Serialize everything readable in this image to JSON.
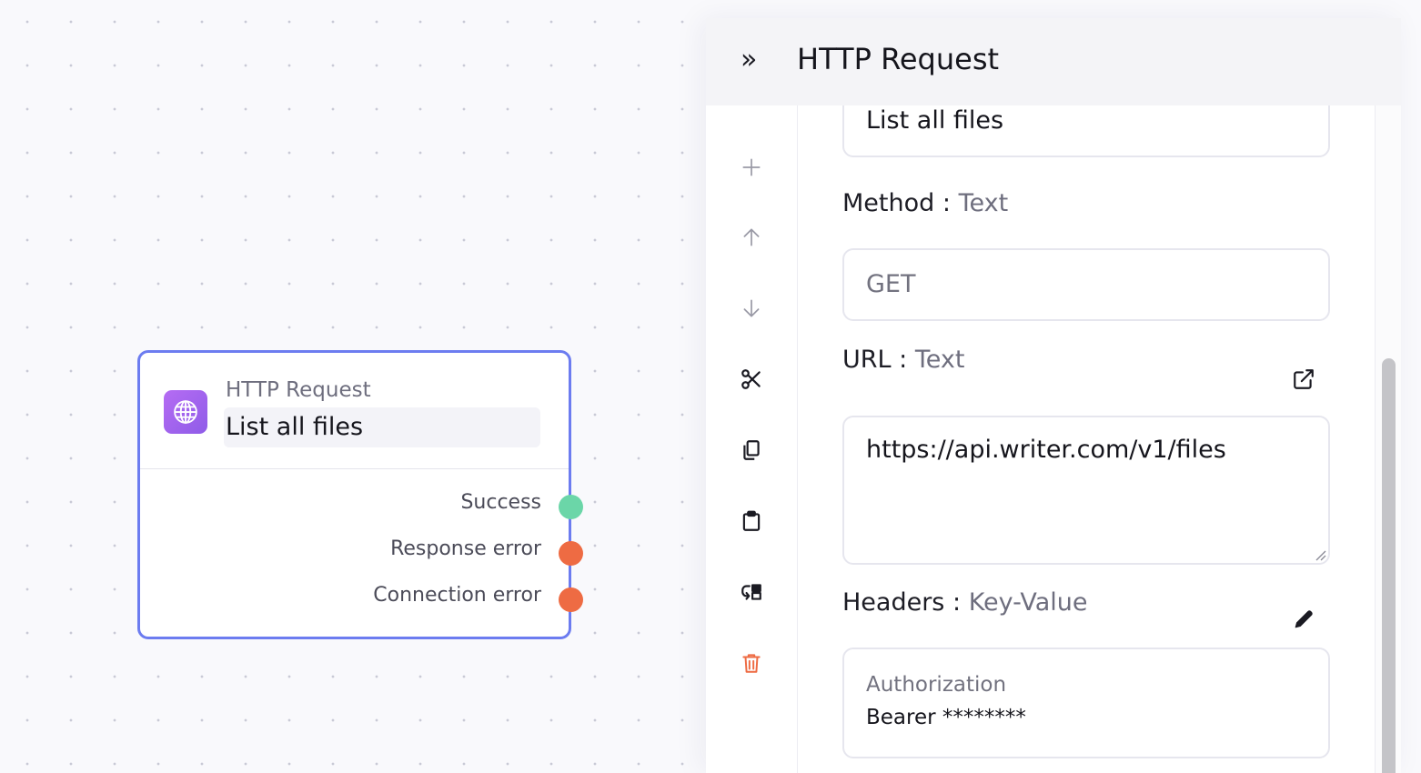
{
  "node": {
    "type_label": "HTTP Request",
    "title": "List all files",
    "outputs": [
      {
        "label": "Success",
        "status": "success",
        "color": "#6bd6a8"
      },
      {
        "label": "Response error",
        "status": "error",
        "color": "#ee6b43"
      },
      {
        "label": "Connection error",
        "status": "error",
        "color": "#ee6b43"
      }
    ]
  },
  "panel": {
    "collapse_glyph": "»",
    "title": "HTTP Request",
    "toolbar": [
      {
        "icon": "plus-icon"
      },
      {
        "icon": "arrow-up-icon"
      },
      {
        "icon": "arrow-down-icon"
      },
      {
        "icon": "scissors-icon"
      },
      {
        "icon": "copy-icon"
      },
      {
        "icon": "clipboard-icon"
      },
      {
        "icon": "go-to-parent-icon"
      },
      {
        "icon": "trash-icon",
        "color": "#ee6b43"
      }
    ],
    "fields": {
      "name": {
        "value": "List all files"
      },
      "method": {
        "label": "Method",
        "type": "Text",
        "separator": ":",
        "placeholder": "GET"
      },
      "url": {
        "label": "URL",
        "type": "Text",
        "separator": ":",
        "value": "https://api.writer.com/v1/files"
      },
      "headers": {
        "label": "Headers",
        "type": "Key-Value",
        "separator": ":",
        "entries": [
          {
            "key": "Authorization",
            "value": "Bearer ********"
          }
        ]
      }
    }
  },
  "colors": {
    "node_border": "#6c7cf0",
    "icon_purple": "#a064ee",
    "accent_red": "#ee6b43",
    "accent_green": "#6bd6a8"
  }
}
